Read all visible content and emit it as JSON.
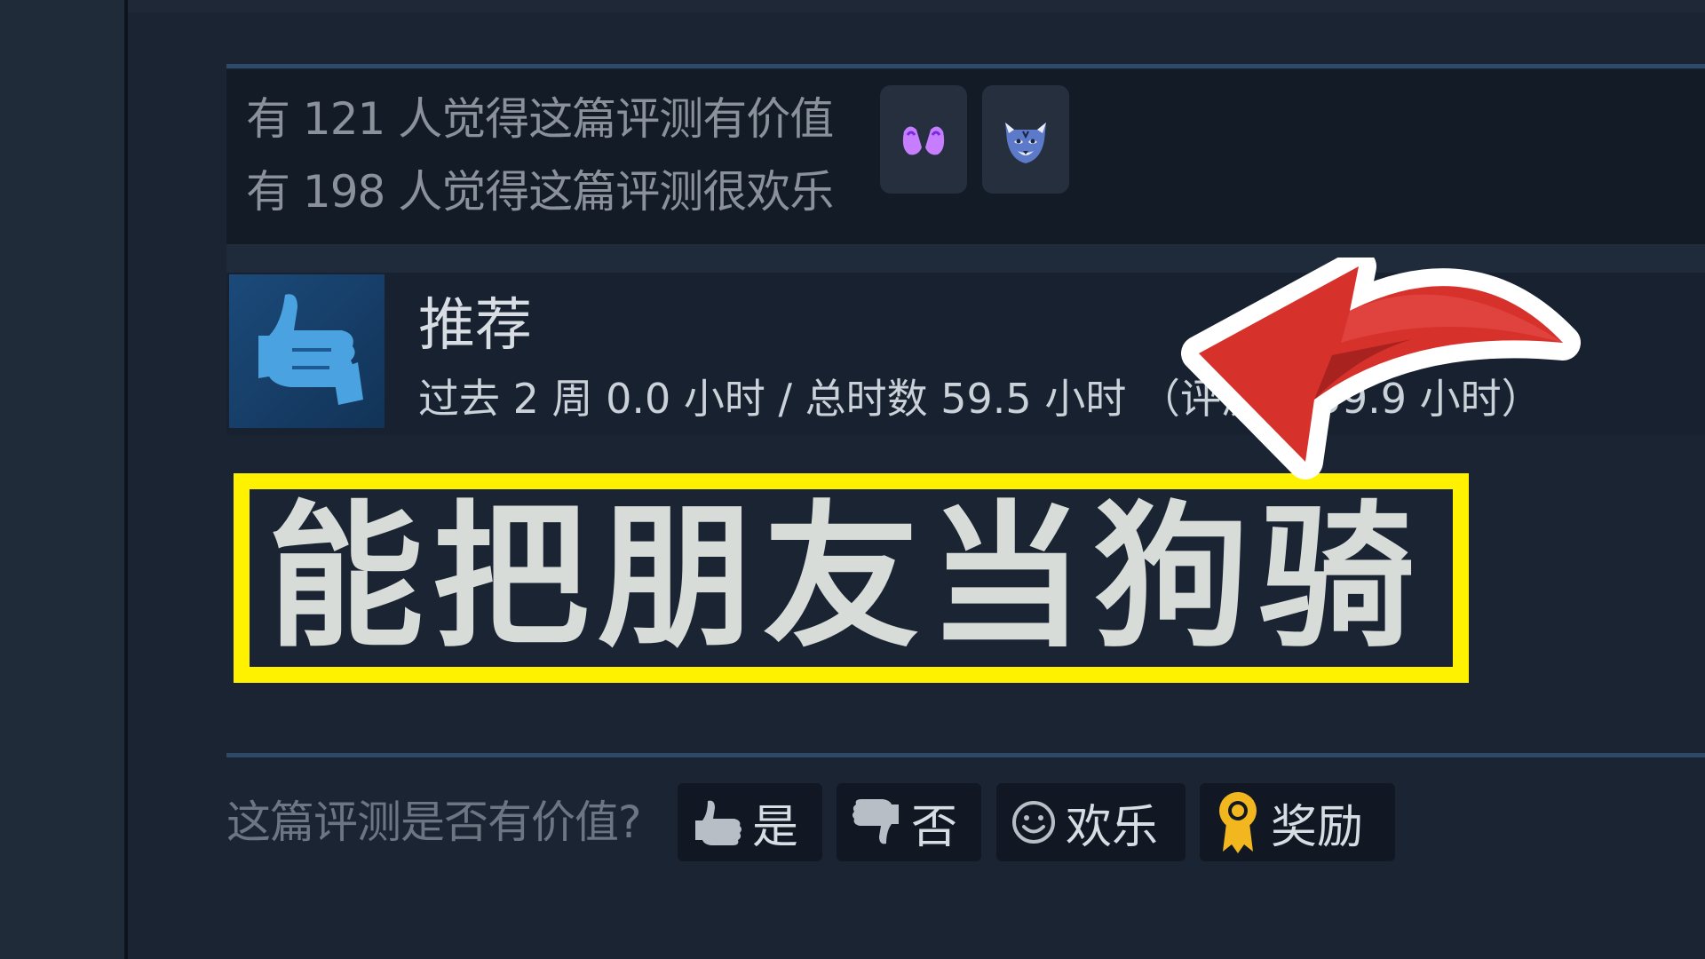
{
  "awards_summary": {
    "helpful_line": "有 121 人觉得这篇评测有价值",
    "funny_line": "有 198 人觉得这篇评测很欢乐",
    "award_icons": [
      "hands-award-icon",
      "tiger-award-icon"
    ]
  },
  "review": {
    "verdict": "推荐",
    "hours_line": "过去 2 周 0.0 小时 / 总时数 59.5 小时 （评测时 59.9 小时）",
    "body": "能把朋友当狗骑"
  },
  "vote_bar": {
    "question": "这篇评测是否有价值?",
    "buttons": [
      {
        "label": "是",
        "icon": "thumbs-up-icon"
      },
      {
        "label": "否",
        "icon": "thumbs-down-icon"
      },
      {
        "label": "欢乐",
        "icon": "smiley-icon"
      },
      {
        "label": "奖励",
        "icon": "award-ribbon-icon"
      }
    ]
  },
  "colors": {
    "page_bg": "#1b2433",
    "panel_bg": "#131b27",
    "highlight_border": "#fff200",
    "arrow_red": "#d7312c",
    "thumb_blue": "#4aa3e0"
  }
}
